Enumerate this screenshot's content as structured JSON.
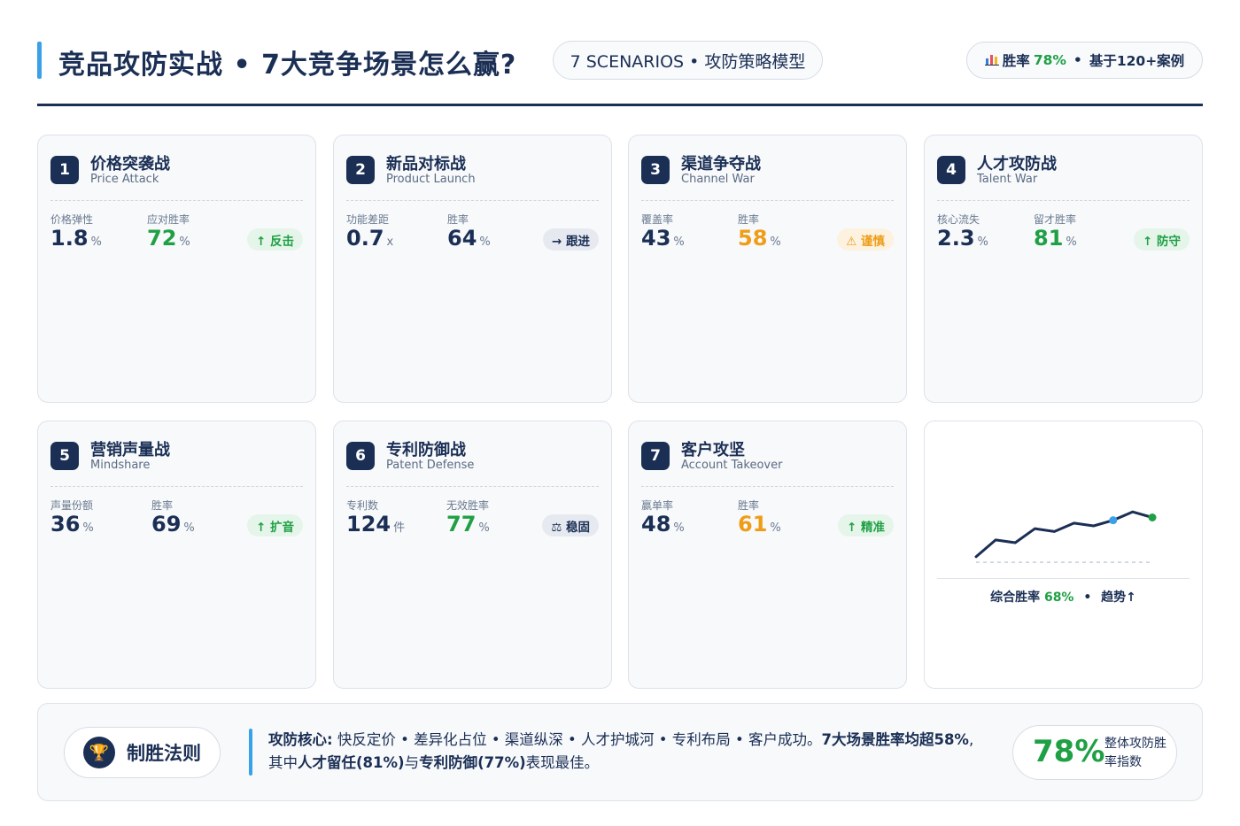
{
  "header": {
    "title": "竞品攻防实战 • 7大竞争场景怎么赢?",
    "scenarios_pill": "7 SCENARIOS • 攻防策略模型",
    "stat_pill": {
      "icon": "bar-chart-icon",
      "label": "胜率",
      "value": "78%",
      "separator": "•",
      "suffix": "基于120+案例"
    }
  },
  "cards": [
    {
      "num": "1",
      "title": "价格突袭战",
      "subtitle": "Price Attack",
      "m1_label": "价格弹性",
      "m1_value": "1.8",
      "m1_unit": "%",
      "m2_label": "应对胜率",
      "m2_value": "72",
      "m2_unit": "%",
      "badge": "↑ 反击"
    },
    {
      "num": "2",
      "title": "新品对标战",
      "subtitle": "Product Launch",
      "m1_label": "功能差距",
      "m1_value": "0.7",
      "m1_unit": "x",
      "m2_label": "胜率",
      "m2_value": "64",
      "m2_unit": "%",
      "badge": "→ 跟进"
    },
    {
      "num": "3",
      "title": "渠道争夺战",
      "subtitle": "Channel War",
      "m1_label": "覆盖率",
      "m1_value": "43",
      "m1_unit": "%",
      "m2_label": "胜率",
      "m2_value": "58",
      "m2_unit": "%",
      "badge": "⚠ 谨慎"
    },
    {
      "num": "4",
      "title": "人才攻防战",
      "subtitle": "Talent War",
      "m1_label": "核心流失",
      "m1_value": "2.3",
      "m1_unit": "%",
      "m2_label": "留才胜率",
      "m2_value": "81",
      "m2_unit": "%",
      "badge": "↑ 防守"
    },
    {
      "num": "5",
      "title": "营销声量战",
      "subtitle": "Mindshare",
      "m1_label": "声量份额",
      "m1_value": "36",
      "m1_unit": "%",
      "m2_label": "胜率",
      "m2_value": "69",
      "m2_unit": "%",
      "badge": "↑ 扩音"
    },
    {
      "num": "6",
      "title": "专利防御战",
      "subtitle": "Patent Defense",
      "m1_label": "专利数",
      "m1_value": "124",
      "m1_unit": "件",
      "m2_label": "无效胜率",
      "m2_value": "77",
      "m2_unit": "%",
      "badge": "⚖ 稳固"
    },
    {
      "num": "7",
      "title": "客户攻坚",
      "subtitle": "Account Takeover",
      "m1_label": "赢单率",
      "m1_value": "48",
      "m1_unit": "%",
      "m2_label": "胜率",
      "m2_value": "61",
      "m2_unit": "%",
      "badge": "↑ 精准"
    }
  ],
  "trend": {
    "caption_label": "综合胜率",
    "caption_value": "68%",
    "separator": "•",
    "caption_trend": "趋势↑"
  },
  "chart_data": {
    "type": "line",
    "title": "",
    "xlabel": "",
    "ylabel": "",
    "x": [
      1,
      2,
      3,
      4,
      5,
      6,
      7,
      8,
      9,
      10
    ],
    "series": [
      {
        "values": [
          52,
          58,
          57,
          62,
          61,
          64,
          63,
          65,
          68,
          66
        ]
      }
    ],
    "baseline": 50,
    "highlight_points": [
      7,
      9
    ],
    "ylim": [
      45,
      75
    ],
    "grid": false
  },
  "footer": {
    "rule_label": "制胜法则",
    "core_label": "攻防核心:",
    "core_items": "快反定价 • 差异化占位 • 渠道纵深 • 人才护城河 • 专利布局 • 客户成功。",
    "summary_bold": "7大场景胜率均超58%",
    "summary_mid": ",其中",
    "talent_bold": "人才留任(81%)",
    "join": "与",
    "patent_bold": "专利防御(77%)",
    "ending": "表现最佳。",
    "index_value": "78%",
    "index_label": "整体攻防胜率指数"
  },
  "colors": {
    "navy": "#1b2f55",
    "accent": "#3aa1e8",
    "green": "#1fa045",
    "orange": "#ef9d18"
  }
}
